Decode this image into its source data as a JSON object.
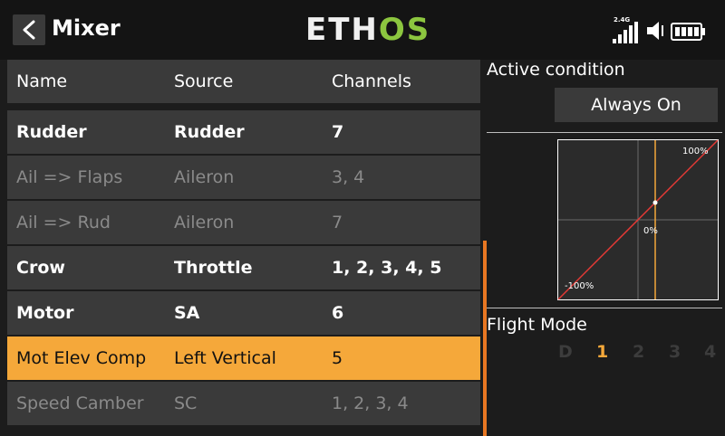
{
  "header": {
    "title": "Mixer",
    "logo_left": "ETH",
    "logo_right": "OS",
    "radio_band": "2.4G"
  },
  "table": {
    "columns": [
      "Name",
      "Source",
      "Channels"
    ],
    "rows": [
      {
        "name": "Rudder",
        "source": "Rudder",
        "channels": "7",
        "state": "active"
      },
      {
        "name": "Ail => Flaps",
        "source": "Aileron",
        "channels": "3, 4",
        "state": "inactive"
      },
      {
        "name": "Ail => Rud",
        "source": "Aileron",
        "channels": "7",
        "state": "inactive"
      },
      {
        "name": "Crow",
        "source": "Throttle",
        "channels": "1, 2, 3, 4, 5",
        "state": "active"
      },
      {
        "name": "Motor",
        "source": "SA",
        "channels": "6",
        "state": "active"
      },
      {
        "name": "Mot Elev Comp",
        "source": "Left Vertical",
        "channels": "5",
        "state": "selected"
      },
      {
        "name": "Speed Camber",
        "source": "SC",
        "channels": "1, 2, 3, 4",
        "state": "inactive"
      }
    ]
  },
  "panel": {
    "active_condition_label": "Active condition",
    "active_condition_value": "Always On",
    "curve": {
      "label_max": "100%",
      "label_mid": "0%",
      "label_min": "-100%"
    },
    "flight_mode_label": "Flight Mode",
    "flight_modes": [
      "D",
      "1",
      "2",
      "3",
      "4"
    ],
    "active_flight_mode": "1"
  },
  "colors": {
    "accent": "#f5a83a",
    "scroll": "#e87722",
    "logo_green": "#8cc63f",
    "curve_line": "#e53935",
    "cursor_line": "#f5a83a"
  }
}
